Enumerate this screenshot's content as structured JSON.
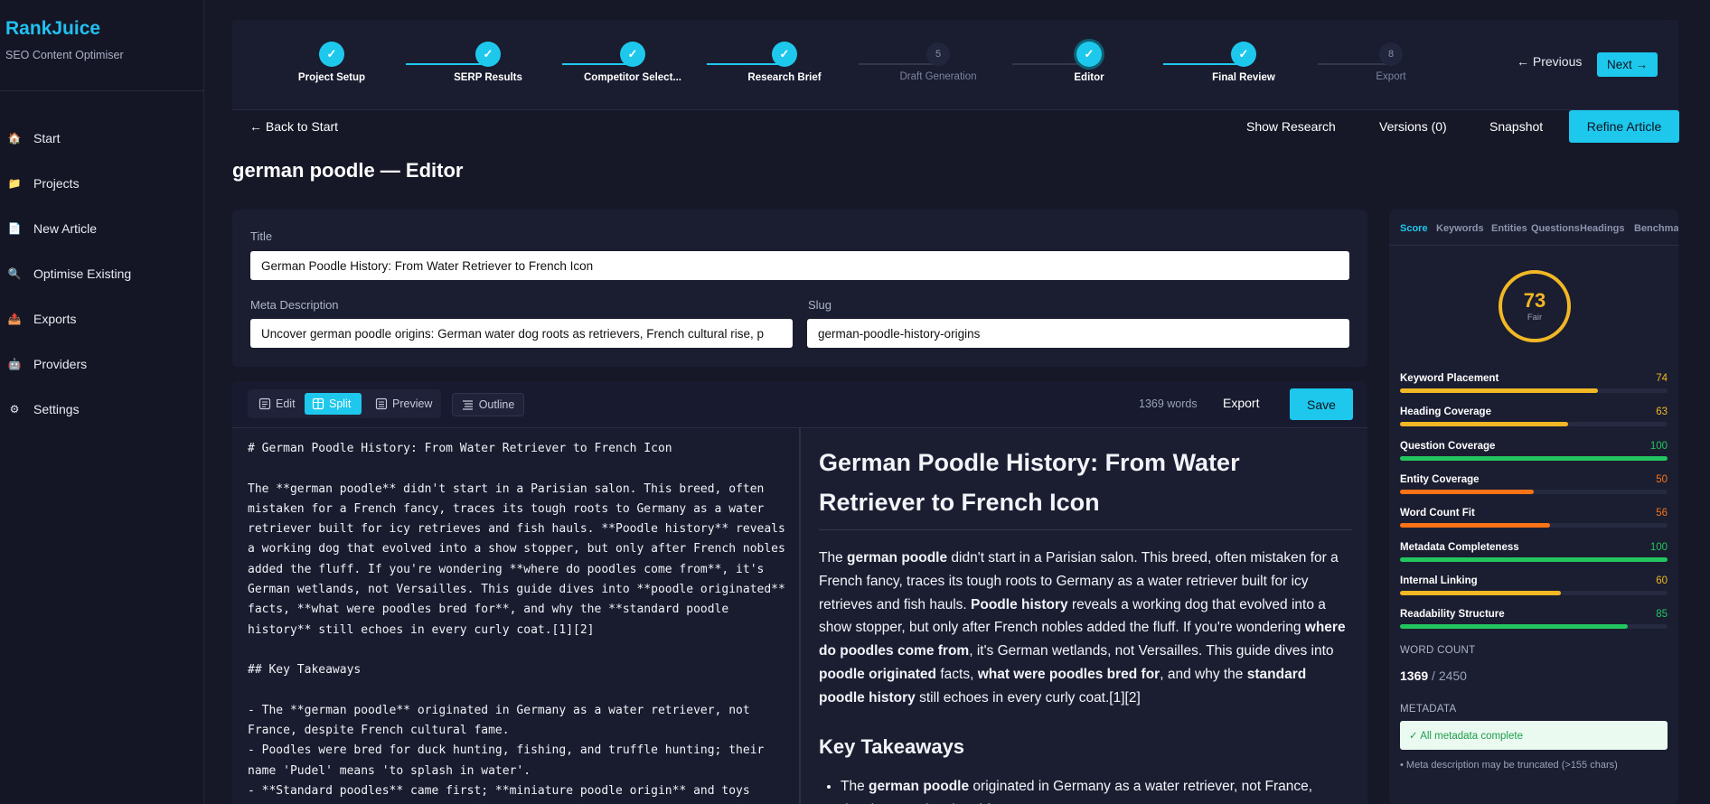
{
  "brand": {
    "name": "RankJuice",
    "tagline": "SEO Content Optimiser"
  },
  "nav": [
    {
      "label": "Start",
      "icon": "house-icon",
      "glyph": "🏠"
    },
    {
      "label": "Projects",
      "icon": "folder-icon",
      "glyph": "📁"
    },
    {
      "label": "New Article",
      "icon": "document-icon",
      "glyph": "📄"
    },
    {
      "label": "Optimise Existing",
      "icon": "magnifier-icon",
      "glyph": "🔍"
    },
    {
      "label": "Exports",
      "icon": "outbox-icon",
      "glyph": "📤"
    },
    {
      "label": "Providers",
      "icon": "robot-icon",
      "glyph": "🤖"
    },
    {
      "label": "Settings",
      "icon": "gear-icon",
      "glyph": "⚙"
    }
  ],
  "steps": [
    {
      "label": "Project Setup",
      "state": "done",
      "mark": "✓"
    },
    {
      "label": "SERP Results",
      "state": "done",
      "mark": "✓"
    },
    {
      "label": "Competitor Select...",
      "state": "done",
      "mark": "✓"
    },
    {
      "label": "Research Brief",
      "state": "done",
      "mark": "✓"
    },
    {
      "label": "Draft Generation",
      "state": "todo",
      "mark": "5"
    },
    {
      "label": "Editor",
      "state": "current",
      "mark": "✓"
    },
    {
      "label": "Final Review",
      "state": "done",
      "mark": "✓"
    },
    {
      "label": "Export",
      "state": "todo",
      "mark": "8"
    }
  ],
  "stepper_nav": {
    "previous": "← Previous",
    "next": "Next →"
  },
  "toolbar": {
    "back": "← Back to Start",
    "show_research": "Show Research",
    "versions": "Versions (0)",
    "snapshot": "Snapshot",
    "refine": "Refine Article"
  },
  "page_title": "german poodle — Editor",
  "form": {
    "title_label": "Title",
    "title_value": "German Poodle History: From Water Retriever to French Icon",
    "meta_label": "Meta Description",
    "meta_value": "Uncover german poodle origins: German water dog roots as retrievers, French cultural rise, p",
    "slug_label": "Slug",
    "slug_value": "german-poodle-history-origins"
  },
  "editor": {
    "modes": {
      "edit": "Edit",
      "split": "Split",
      "preview": "Preview"
    },
    "active_mode": "Split",
    "outline": "Outline",
    "word_count": "1369 words",
    "export": "Export",
    "save": "Save",
    "source": "# German Poodle History: From Water Retriever to French Icon\n\nThe **german poodle** didn't start in a Parisian salon. This breed, often\nmistaken for a French fancy, traces its tough roots to Germany as a water\nretriever built for icy retrieves and fish hauls. **Poodle history** reveals\na working dog that evolved into a show stopper, but only after French nobles\nadded the fluff. If you're wondering **where do poodles come from**, it's\nGerman wetlands, not Versailles. This guide dives into **poodle originated**\nfacts, **what were poodles bred for**, and why the **standard poodle\nhistory** still echoes in every curly coat.[1][2]\n\n## Key Takeaways\n\n- The **german poodle** originated in Germany as a water retriever, not\nFrance, despite French cultural fame.\n- Poodles were bred for duck hunting, fishing, and truffle hunting; their\nname 'Pudel' means 'to splash in water'.\n- **Standard poodles** came first; **miniature poodle origin** and toys",
    "preview": {
      "h1": "German Poodle History: From Water Retriever to French Icon",
      "p_parts": [
        {
          "t": "The ",
          "b": false
        },
        {
          "t": "german poodle",
          "b": true
        },
        {
          "t": " didn't start in a Parisian salon. This breed, often mistaken for a French fancy, traces its tough roots to Germany as a water retriever built for icy retrieves and fish hauls. ",
          "b": false
        },
        {
          "t": "Poodle history",
          "b": true
        },
        {
          "t": " reveals a working dog that evolved into a show stopper, but only after French nobles added the fluff. If you're wondering ",
          "b": false
        },
        {
          "t": "where do poodles come from",
          "b": true
        },
        {
          "t": ", it's German wetlands, not Versailles. This guide dives into ",
          "b": false
        },
        {
          "t": "poodle originated",
          "b": true
        },
        {
          "t": " facts, ",
          "b": false
        },
        {
          "t": "what were poodles bred for",
          "b": true
        },
        {
          "t": ", and why the ",
          "b": false
        },
        {
          "t": "standard poodle history",
          "b": true
        },
        {
          "t": " still echoes in every curly coat.[1][2]",
          "b": false
        }
      ],
      "h2": "Key Takeaways",
      "li1_parts": [
        {
          "t": "The ",
          "b": false
        },
        {
          "t": "german poodle",
          "b": true
        },
        {
          "t": " originated in Germany as a water retriever, not France, despite French cultural fame.",
          "b": false
        }
      ]
    }
  },
  "panel": {
    "tabs": [
      "Score",
      "Keywords",
      "Entities",
      "Questions",
      "Headings",
      "Benchma"
    ],
    "active_tab": "Score",
    "score": {
      "value": "73",
      "label": "Fair",
      "color": "#f2b724"
    },
    "metrics": [
      {
        "name": "Keyword Placement",
        "value": 74,
        "color": "#f2b724"
      },
      {
        "name": "Heading Coverage",
        "value": 63,
        "color": "#f2b724"
      },
      {
        "name": "Question Coverage",
        "value": 100,
        "color": "#22c55e"
      },
      {
        "name": "Entity Coverage",
        "value": 50,
        "color": "#f97316"
      },
      {
        "name": "Word Count Fit",
        "value": 56,
        "color": "#f97316"
      },
      {
        "name": "Metadata Completeness",
        "value": 100,
        "color": "#22c55e"
      },
      {
        "name": "Internal Linking",
        "value": 60,
        "color": "#f2b724"
      },
      {
        "name": "Readability Structure",
        "value": 85,
        "color": "#22c55e"
      }
    ],
    "word_count_heading": "WORD COUNT",
    "word_count_value": "1369",
    "word_count_target": "/ 2450",
    "metadata_heading": "METADATA",
    "metadata_ok": "✓ All metadata complete",
    "metadata_warning": "Meta description may be truncated (>155 chars)"
  }
}
